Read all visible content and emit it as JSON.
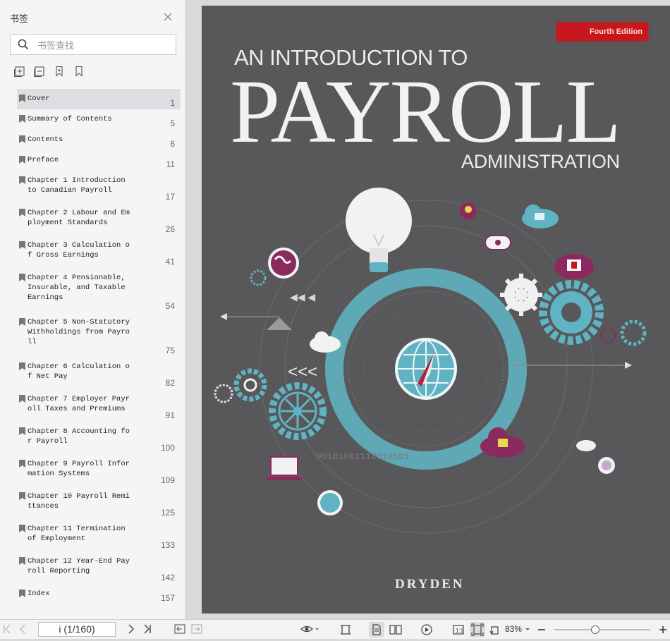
{
  "sidebar": {
    "title": "书签",
    "search_placeholder": "书签查找",
    "bookmarks": [
      {
        "label": "Cover",
        "page": "1"
      },
      {
        "label": "Summary of Contents",
        "page": "5"
      },
      {
        "label": "Contents",
        "page": "6"
      },
      {
        "label": "Preface",
        "page": "11"
      },
      {
        "label": "Chapter 1 Introduction to Canadian Payroll",
        "page": "17"
      },
      {
        "label": "Chapter 2 Labour and Employment Standards",
        "page": "26"
      },
      {
        "label": "Chapter 3 Calculation of Gross Earnings",
        "page": "41"
      },
      {
        "label": "Chapter 4 Pensionable, Insurable, and Taxable Earnings",
        "page": "54"
      },
      {
        "label": "Chapter 5 Non-Statutory Withholdings from Payroll",
        "page": "75"
      },
      {
        "label": "Chapter 6 Calculation of Net Pay",
        "page": "82"
      },
      {
        "label": "Chapter 7 Employer Payroll Taxes and Premiums",
        "page": "91"
      },
      {
        "label": "Chapter 8 Accounting for Payroll",
        "page": "100"
      },
      {
        "label": "Chapter 9 Payroll Information Systems",
        "page": "109"
      },
      {
        "label": "Chapter 10 Payroll Remittances",
        "page": "125"
      },
      {
        "label": "Chapter 11 Termination of Employment",
        "page": "133"
      },
      {
        "label": "Chapter 12 Year-End Payroll Reporting",
        "page": "142"
      },
      {
        "label": "Index",
        "page": "157"
      }
    ]
  },
  "cover": {
    "edition_badge": "Fourth Edition",
    "title_line1": "AN INTRODUCTION TO",
    "title_line2": "PAYROLL",
    "title_line3": "ADMINISTRATION",
    "binary_text": "00101001110010101",
    "author": "DRYDEN",
    "background_color": "#58585b",
    "accent_color": "#5fb3c2"
  },
  "toolbar": {
    "page_indicator": "i (1/160)",
    "zoom": "83%",
    "zoom_fraction": 0.42
  }
}
